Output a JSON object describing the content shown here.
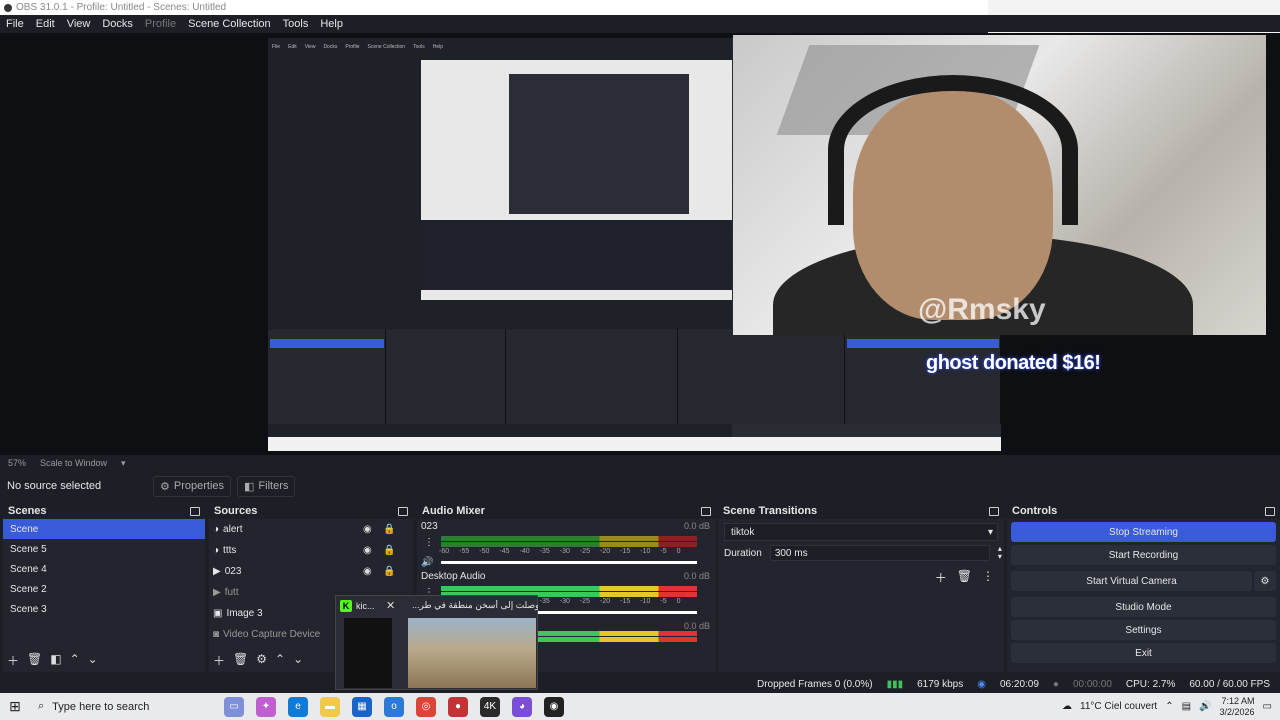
{
  "window": {
    "title": "OBS 31.0.1 - Profile: Untitled - Scenes: Untitled"
  },
  "menu": [
    "File",
    "Edit",
    "View",
    "Docks",
    "Profile",
    "Scene Collection",
    "Tools",
    "Help"
  ],
  "preview": {
    "watermark": "@Rmsky",
    "donation": "ghost donated $16!"
  },
  "scale": {
    "zoom": "57%",
    "mode": "Scale to Window"
  },
  "props_bar": {
    "status": "No source selected",
    "properties": "Properties",
    "filters": "Filters"
  },
  "scenes": {
    "title": "Scenes",
    "items": [
      "Scene",
      "Scene 5",
      "Scene 4",
      "Scene 2",
      "Scene 3"
    ]
  },
  "sources": {
    "title": "Sources",
    "items": [
      "alert",
      "ttts",
      "023",
      "futt",
      "Image 3",
      "Video Capture Device"
    ]
  },
  "audio_mixer": {
    "title": "Audio Mixer",
    "channels": [
      {
        "name": "023",
        "db": "0.0 dB"
      },
      {
        "name": "Desktop Audio",
        "db": "0.0 dB"
      },
      {
        "name": "",
        "db": "0.0 dB"
      }
    ],
    "ticks": [
      "-60",
      "-55",
      "-50",
      "-45",
      "-40",
      "-35",
      "-30",
      "-25",
      "-20",
      "-15",
      "-10",
      "-5",
      "0"
    ]
  },
  "transitions": {
    "title": "Scene Transitions",
    "selected": "tiktok",
    "duration_label": "Duration",
    "duration_value": "300 ms"
  },
  "controls": {
    "title": "Controls",
    "stop_streaming": "Stop Streaming",
    "start_recording": "Start Recording",
    "start_virtual_camera": "Start Virtual Camera",
    "studio_mode": "Studio Mode",
    "settings": "Settings",
    "exit": "Exit"
  },
  "status": {
    "dropped_frames": "Dropped Frames 0 (0.0%)",
    "bitrate": "6179 kbps",
    "stream_time": "06:20:09",
    "rec_time": "00:00:00",
    "cpu": "CPU: 2.7%",
    "fps": "60.00 / 60.00 FPS"
  },
  "popup": {
    "tab1": "kic...",
    "tab2": "...وصلت إلى أسخن منطقة في طر"
  },
  "taskbar": {
    "search_placeholder": "Type here to search",
    "weather": "11°C  Ciel couvert",
    "time": "7:12 AM",
    "date": "3/2/2026"
  },
  "colors": {
    "accent": "#3a5bd9",
    "bg": "#1d1f26",
    "panel": "#22252d"
  }
}
